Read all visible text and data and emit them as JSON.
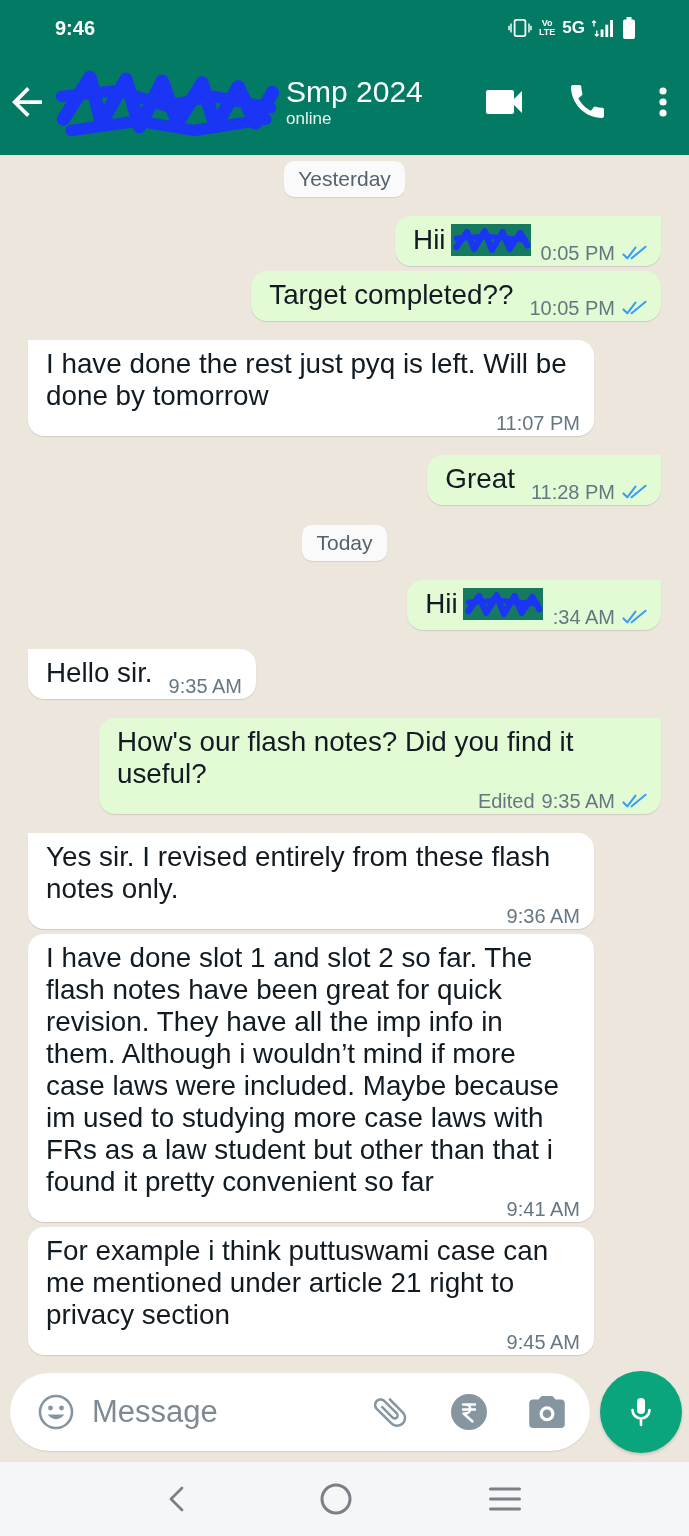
{
  "status_bar": {
    "time": "9:46",
    "volte": [
      "Vo",
      "LTE"
    ],
    "network": "5G"
  },
  "header": {
    "redacted": true,
    "title": "Smp 2024",
    "status": "online"
  },
  "messages": [
    {
      "kind": "date",
      "text": "Yesterday"
    },
    {
      "kind": "outgoing",
      "text": "Hii",
      "redacted": true,
      "time": "0:05 PM",
      "tail": true,
      "read": true
    },
    {
      "kind": "outgoing",
      "text": "Target completed??",
      "redacted": false,
      "time": "10:05 PM",
      "tail": false,
      "read": true
    },
    {
      "kind": "incoming",
      "text": "I have done the rest just pyq is left. Will be done by tomorrow",
      "redacted": false,
      "time": "11:07 PM",
      "tail": true
    },
    {
      "kind": "outgoing",
      "text": "Great",
      "redacted": false,
      "time": "11:28 PM",
      "tail": true,
      "read": true
    },
    {
      "kind": "date",
      "text": "Today"
    },
    {
      "kind": "outgoing",
      "text": "Hii",
      "redacted": true,
      "time": ":34 AM",
      "tail": true,
      "read": true
    },
    {
      "kind": "incoming",
      "text": "Hello sir.",
      "redacted": false,
      "time": "9:35 AM",
      "tail": true
    },
    {
      "kind": "outgoing",
      "text": "How's our flash notes? Did you find it useful?",
      "redacted": false,
      "edited": "Edited",
      "time": "9:35 AM",
      "tail": true,
      "read": true
    },
    {
      "kind": "incoming",
      "text": "Yes sir. I revised entirely from these flash notes only.",
      "redacted": false,
      "time": "9:36 AM",
      "tail": true
    },
    {
      "kind": "incoming",
      "text": "I have done slot 1 and slot 2 so far. The flash notes have been great for quick revision. They have all the imp info in them. Although i wouldn’t mind if more case laws were included. Maybe because im used to studying more case laws with FRs as a law student but other than that i found it pretty convenient so far",
      "redacted": false,
      "time": "9:41 AM",
      "tail": false
    },
    {
      "kind": "incoming",
      "text": "For example i think puttuswami case can me mentioned under article 21 right to privacy section",
      "redacted": false,
      "time": "9:45 AM",
      "tail": false
    }
  ],
  "composer": {
    "placeholder": "Message"
  }
}
